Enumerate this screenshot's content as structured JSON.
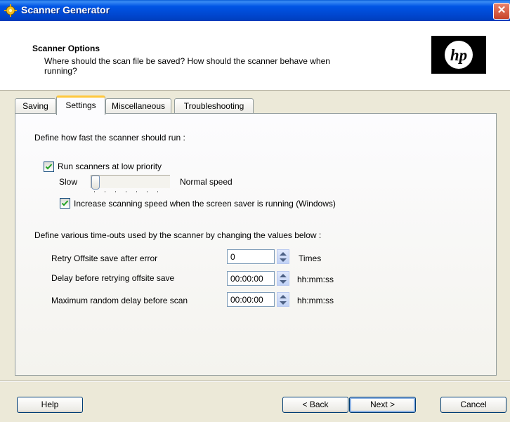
{
  "window": {
    "title": "Scanner Generator",
    "close_glyph": "✕"
  },
  "header": {
    "title": "Scanner Options",
    "description": "Where should the scan file be saved?  How should the scanner behave when running?",
    "logo_icon": "hp-logo",
    "logo_text": "hp"
  },
  "tabs": [
    {
      "label": "Saving",
      "active": false
    },
    {
      "label": "Settings",
      "active": true
    },
    {
      "label": "Miscellaneous",
      "active": false
    },
    {
      "label": "Troubleshooting",
      "active": false
    }
  ],
  "settings": {
    "speed_heading": "Define how fast the scanner should run :",
    "low_priority_label": "Run scanners at low priority",
    "low_priority_checked": true,
    "slider_min_label": "Slow",
    "slider_max_label": "Normal speed",
    "slider_value": 0,
    "screensaver_label": "Increase scanning speed when the screen saver is running (Windows)",
    "screensaver_checked": true,
    "timeouts_heading": "Define various time-outs used by the scanner by changing the values below :",
    "timeouts": [
      {
        "label": "Retry Offsite save after error",
        "value": "0",
        "unit": "Times"
      },
      {
        "label": "Delay before retrying offsite save",
        "value": "00:00:00",
        "unit": "hh:mm:ss"
      },
      {
        "label": "Maximum random delay before scan",
        "value": "00:00:00",
        "unit": "hh:mm:ss"
      }
    ]
  },
  "buttons": {
    "help": "Help",
    "back": "< Back",
    "next": "Next >",
    "cancel": "Cancel"
  },
  "colors": {
    "titlebar": "#0054e3",
    "tab_highlight": "#ffc83c",
    "check": "#21a121"
  }
}
